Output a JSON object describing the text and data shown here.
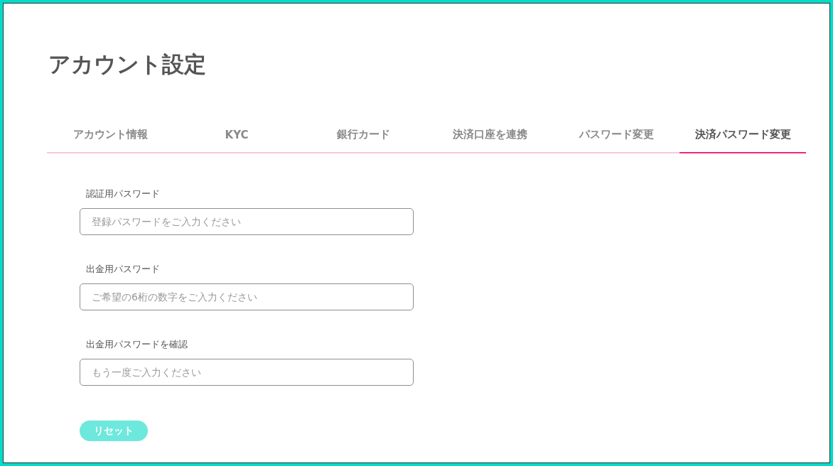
{
  "page": {
    "title": "アカウント設定"
  },
  "tabs": [
    {
      "label": "アカウント情報",
      "selected": false
    },
    {
      "label": "KYC",
      "selected": false
    },
    {
      "label": "銀行カード",
      "selected": false
    },
    {
      "label": "決済口座を連携",
      "selected": false
    },
    {
      "label": "パスワード変更",
      "selected": false
    },
    {
      "label": "決済パスワード変更",
      "selected": true
    }
  ],
  "form": {
    "fields": [
      {
        "label": "認証用パスワード",
        "placeholder": "登録パスワードをご入力ください"
      },
      {
        "label": "出金用パスワード",
        "placeholder": "ご希望の6桁の数字をご入力ください"
      },
      {
        "label": "出金用パスワードを確認",
        "placeholder": "もう一度ご入力ください"
      }
    ],
    "button": "リセット"
  }
}
